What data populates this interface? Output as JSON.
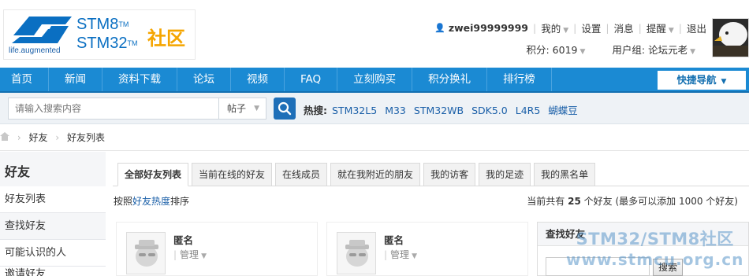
{
  "header": {
    "logo_tagline": "life.augmented",
    "logo_line1": "STM8",
    "logo_line2": "STM32",
    "logo_tm": "TM",
    "logo_cn": "社区",
    "username": "zwei99999999",
    "menu_mine": "我的",
    "menu_settings": "设置",
    "menu_messages": "消息",
    "menu_alerts": "提醒",
    "menu_logout": "退出",
    "points": "积分: 6019",
    "usergroup": "用户组: 论坛元老"
  },
  "nav": {
    "items": [
      "首页",
      "新闻",
      "资料下载",
      "论坛",
      "视频",
      "FAQ",
      "立刻购买",
      "积分换礼",
      "排行榜"
    ],
    "quick_nav": "快捷导航"
  },
  "search": {
    "placeholder": "请输入搜索内容",
    "type": "帖子",
    "hot_label": "热搜:",
    "hot_keywords": [
      "STM32L5",
      "M33",
      "STM32WB",
      "SDK5.0",
      "L4R5",
      "蝴蝶豆"
    ]
  },
  "breadcrumb": [
    "好友",
    "好友列表"
  ],
  "sidebar": {
    "title": "好友",
    "items": [
      "好友列表",
      "查找好友",
      "可能认识的人",
      "邀请好友"
    ]
  },
  "tabs": [
    "全部好友列表",
    "当前在线的好友",
    "在线成员",
    "就在我附近的朋友",
    "我的访客",
    "我的足迹",
    "我的黑名单"
  ],
  "sort": {
    "prefix": "按照",
    "key": "好友热度",
    "suffix": "排序"
  },
  "count": {
    "prefix": "当前共有",
    "num": "25",
    "suffix": "个好友 (最多可以添加 1000 个好友)"
  },
  "friends": [
    {
      "name": "匿名",
      "action": "管理"
    },
    {
      "name": "匿名",
      "action": "管理"
    }
  ],
  "find": {
    "title": "查找好友",
    "button": "搜索"
  },
  "watermark": {
    "line1": "STM32/STM8社区",
    "line2": "www.stmcu.org.cn"
  }
}
